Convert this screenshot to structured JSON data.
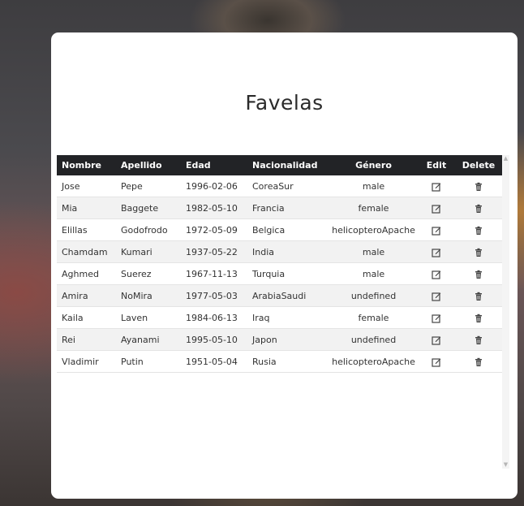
{
  "page": {
    "title": "Favelas"
  },
  "table": {
    "headers": {
      "nombre": "Nombre",
      "apellido": "Apellido",
      "edad": "Edad",
      "nacionalidad": "Nacionalidad",
      "genero": "Género",
      "edit": "Edit",
      "delete": "Delete"
    },
    "rows": [
      {
        "nombre": "Jose",
        "apellido": "Pepe",
        "edad": "1996-02-06",
        "nacionalidad": "CoreaSur",
        "genero": "male"
      },
      {
        "nombre": "Mia",
        "apellido": "Baggete",
        "edad": "1982-05-10",
        "nacionalidad": "Francia",
        "genero": "female"
      },
      {
        "nombre": "Elillas",
        "apellido": "Godofrodo",
        "edad": "1972-05-09",
        "nacionalidad": "Belgica",
        "genero": "helicopteroApache"
      },
      {
        "nombre": "Chamdam",
        "apellido": "Kumari",
        "edad": "1937-05-22",
        "nacionalidad": "India",
        "genero": "male"
      },
      {
        "nombre": "Aghmed",
        "apellido": "Suerez",
        "edad": "1967-11-13",
        "nacionalidad": "Turquia",
        "genero": "male"
      },
      {
        "nombre": "Amira",
        "apellido": "NoMira",
        "edad": "1977-05-03",
        "nacionalidad": "ArabiaSaudi",
        "genero": "undefined"
      },
      {
        "nombre": "Kaila",
        "apellido": "Laven",
        "edad": "1984-06-13",
        "nacionalidad": "Iraq",
        "genero": "female"
      },
      {
        "nombre": "Rei",
        "apellido": "Ayanami",
        "edad": "1995-05-10",
        "nacionalidad": "Japon",
        "genero": "undefined"
      },
      {
        "nombre": "Vladimir",
        "apellido": "Putin",
        "edad": "1951-05-04",
        "nacionalidad": "Rusia",
        "genero": "helicopteroApache"
      }
    ],
    "edit_icon": "edit-icon",
    "delete_icon": "trash-icon"
  },
  "colors": {
    "header_bg": "#222326",
    "row_alt": "#f2f2f2"
  }
}
